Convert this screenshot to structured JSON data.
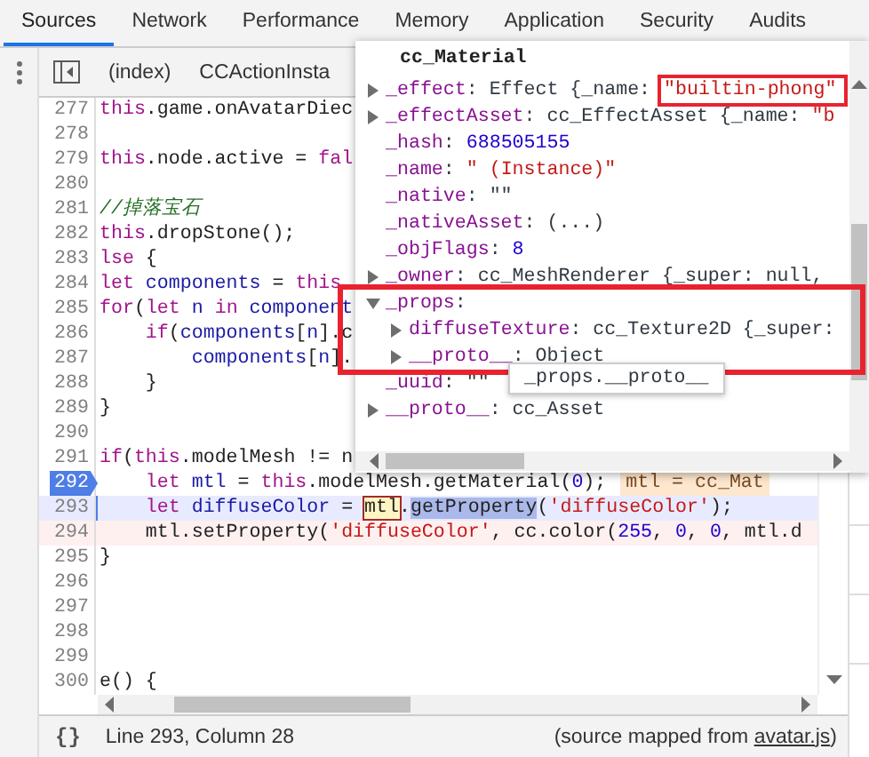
{
  "tabs": [
    {
      "label": "Sources",
      "selected": true
    },
    {
      "label": "Network",
      "selected": false
    },
    {
      "label": "Performance",
      "selected": false
    },
    {
      "label": "Memory",
      "selected": false
    },
    {
      "label": "Application",
      "selected": false
    },
    {
      "label": "Security",
      "selected": false
    },
    {
      "label": "Audits",
      "selected": false
    }
  ],
  "toolbar": {
    "file_tabs": [
      {
        "label": "(index)"
      },
      {
        "label": "CCActionInsta"
      }
    ]
  },
  "editor": {
    "lines": [
      {
        "number": "277",
        "kind": "normal",
        "tokens": [
          {
            "kind": "keyword",
            "text": "this"
          },
          {
            "kind": "plain",
            "text": ".game.onAvatarDiec"
          }
        ]
      },
      {
        "number": "278",
        "kind": "normal"
      },
      {
        "number": "279",
        "kind": "normal",
        "tokens": [
          {
            "kind": "keyword",
            "text": "this"
          },
          {
            "kind": "plain",
            "text": ".node.active = "
          },
          {
            "kind": "keyword",
            "text": "fal"
          }
        ]
      },
      {
        "number": "280",
        "kind": "normal"
      },
      {
        "number": "281",
        "kind": "normal",
        "tokens": [
          {
            "kind": "comment",
            "text": "//掉落宝石"
          }
        ]
      },
      {
        "number": "282",
        "kind": "normal",
        "tokens": [
          {
            "kind": "keyword",
            "text": "this"
          },
          {
            "kind": "plain",
            "text": ".dropStone();"
          }
        ]
      },
      {
        "number": "283",
        "kind": "normal",
        "tokens": [
          {
            "kind": "keyword",
            "text": "lse"
          },
          {
            "kind": "plain",
            "text": " {"
          }
        ]
      },
      {
        "number": "284",
        "kind": "normal",
        "tokens": [
          {
            "kind": "keyword",
            "text": "let"
          },
          {
            "kind": "variable",
            "text": " components"
          },
          {
            "kind": "plain",
            "text": " = "
          },
          {
            "kind": "keyword",
            "text": "this"
          }
        ]
      },
      {
        "number": "285",
        "kind": "normal",
        "tokens": [
          {
            "kind": "keyword",
            "text": "for"
          },
          {
            "kind": "plain",
            "text": "("
          },
          {
            "kind": "keyword",
            "text": "let"
          },
          {
            "kind": "variable",
            "text": " n"
          },
          {
            "kind": "keyword",
            "text": " in"
          },
          {
            "kind": "variable",
            "text": " component"
          }
        ]
      },
      {
        "number": "286",
        "kind": "normal",
        "tokens": [
          {
            "kind": "keyword",
            "text": "    if"
          },
          {
            "kind": "plain",
            "text": "("
          },
          {
            "kind": "variable",
            "text": "components"
          },
          {
            "kind": "plain",
            "text": "["
          },
          {
            "kind": "variable",
            "text": "n"
          },
          {
            "kind": "plain",
            "text": "].c"
          }
        ]
      },
      {
        "number": "287",
        "kind": "normal",
        "tokens": [
          {
            "kind": "variable",
            "text": "        components"
          },
          {
            "kind": "plain",
            "text": "["
          },
          {
            "kind": "variable",
            "text": "n"
          },
          {
            "kind": "plain",
            "text": "]."
          }
        ]
      },
      {
        "number": "288",
        "kind": "normal",
        "tokens": [
          {
            "kind": "plain",
            "text": "    }"
          }
        ]
      },
      {
        "number": "289",
        "kind": "normal",
        "tokens": [
          {
            "kind": "plain",
            "text": "}"
          }
        ]
      },
      {
        "number": "290",
        "kind": "normal"
      },
      {
        "number": "291",
        "kind": "normal",
        "tokens": [
          {
            "kind": "keyword",
            "text": "if"
          },
          {
            "kind": "plain",
            "text": "("
          },
          {
            "kind": "keyword",
            "text": "this"
          },
          {
            "kind": "plain",
            "text": ".modelMesh != n"
          }
        ]
      },
      {
        "number": "292",
        "kind": "breakpoint",
        "tokens": [
          {
            "kind": "keyword",
            "text": "    let"
          },
          {
            "kind": "variable",
            "text": " mtl"
          },
          {
            "kind": "plain",
            "text": " = "
          },
          {
            "kind": "keyword",
            "text": "this"
          },
          {
            "kind": "plain",
            "text": ".modelMesh.getMaterial("
          },
          {
            "kind": "number",
            "text": "0"
          },
          {
            "kind": "plain",
            "text": ");"
          }
        ],
        "inline_value": "mtl = cc_Mat"
      },
      {
        "number": "293",
        "kind": "paused",
        "tokens": [
          {
            "kind": "keyword",
            "text": "    let"
          },
          {
            "kind": "variable",
            "text": " diffuseColor"
          },
          {
            "kind": "plain",
            "text": " = "
          },
          {
            "kind": "match",
            "text": "mtl"
          },
          {
            "kind": "plain",
            "text": "."
          },
          {
            "kind": "selection",
            "text": "getProperty"
          },
          {
            "kind": "plain",
            "text": "("
          },
          {
            "kind": "string",
            "text": "'diffuseColor'"
          },
          {
            "kind": "plain",
            "text": ");"
          }
        ]
      },
      {
        "number": "294",
        "kind": "evaluated",
        "tokens": [
          {
            "kind": "plain",
            "text": "    mtl.setProperty("
          },
          {
            "kind": "string",
            "text": "'diffuseColor'"
          },
          {
            "kind": "plain",
            "text": ", cc.color("
          },
          {
            "kind": "number",
            "text": "255"
          },
          {
            "kind": "plain",
            "text": ", "
          },
          {
            "kind": "number",
            "text": "0"
          },
          {
            "kind": "plain",
            "text": ", "
          },
          {
            "kind": "number",
            "text": "0"
          },
          {
            "kind": "plain",
            "text": ", mtl.d"
          }
        ]
      },
      {
        "number": "295",
        "kind": "normal",
        "tokens": [
          {
            "kind": "plain",
            "text": "}"
          }
        ]
      },
      {
        "number": "296",
        "kind": "normal"
      },
      {
        "number": "297",
        "kind": "normal"
      },
      {
        "number": "298",
        "kind": "normal"
      },
      {
        "number": "299",
        "kind": "normal"
      },
      {
        "number": "300",
        "kind": "normal",
        "tokens": [
          {
            "kind": "plain",
            "text": "e() {"
          }
        ]
      }
    ]
  },
  "popover": {
    "title": "cc_Material",
    "rows": [
      {
        "key": "_effect",
        "expandable": true,
        "expanded": false,
        "value": [
          {
            "kind": "plain",
            "text": ": Effect {_name: "
          },
          {
            "kind": "string",
            "text": "\"builtin-phong\"",
            "outlined": true
          }
        ]
      },
      {
        "key": "_effectAsset",
        "expandable": true,
        "expanded": false,
        "value": [
          {
            "kind": "plain",
            "text": ": cc_EffectAsset {_name: "
          },
          {
            "kind": "string",
            "text": "\"b"
          }
        ]
      },
      {
        "key": "_hash",
        "expandable": false,
        "value": [
          {
            "kind": "plain",
            "text": ": "
          },
          {
            "kind": "number",
            "text": "688505155"
          }
        ]
      },
      {
        "key": "_name",
        "expandable": false,
        "value": [
          {
            "kind": "plain",
            "text": ": "
          },
          {
            "kind": "string",
            "text": "\" (Instance)\""
          }
        ]
      },
      {
        "key": "_native",
        "expandable": false,
        "value": [
          {
            "kind": "plain",
            "text": ": \"\""
          }
        ]
      },
      {
        "key": "_nativeAsset",
        "expandable": false,
        "value": [
          {
            "kind": "plain",
            "text": ": (...)"
          }
        ]
      },
      {
        "key": "_objFlags",
        "expandable": false,
        "value": [
          {
            "kind": "plain",
            "text": ": "
          },
          {
            "kind": "number",
            "text": "8"
          }
        ]
      },
      {
        "key": "_owner",
        "expandable": true,
        "expanded": false,
        "value": [
          {
            "kind": "plain",
            "text": ": cc_MeshRenderer {_super: null,"
          }
        ]
      },
      {
        "key": "_props",
        "expandable": true,
        "expanded": true,
        "outlined": true,
        "value": [
          {
            "kind": "plain",
            "text": ":"
          }
        ],
        "children": [
          {
            "key": "diffuseTexture",
            "expandable": true,
            "expanded": false,
            "value": [
              {
                "kind": "plain",
                "text": ": cc_Texture2D {_super:"
              }
            ]
          },
          {
            "key": "__proto__",
            "expandable": true,
            "expanded": false,
            "value": [
              {
                "kind": "plain",
                "text": ": Object"
              }
            ]
          }
        ]
      },
      {
        "key": "_uuid",
        "expandable": false,
        "value": [
          {
            "kind": "plain",
            "text": ": \"\""
          }
        ]
      },
      {
        "key": "__proto__",
        "expandable": true,
        "expanded": false,
        "value": [
          {
            "kind": "plain",
            "text": ": cc_Asset"
          }
        ]
      }
    ],
    "tooltip": "_props.__proto__"
  },
  "status_bar": {
    "pretty_print": "{}",
    "position": "Line 293, Column 28",
    "source_prefix": "(source mapped from ",
    "source_link": "avatar.js",
    "source_suffix": ")"
  }
}
